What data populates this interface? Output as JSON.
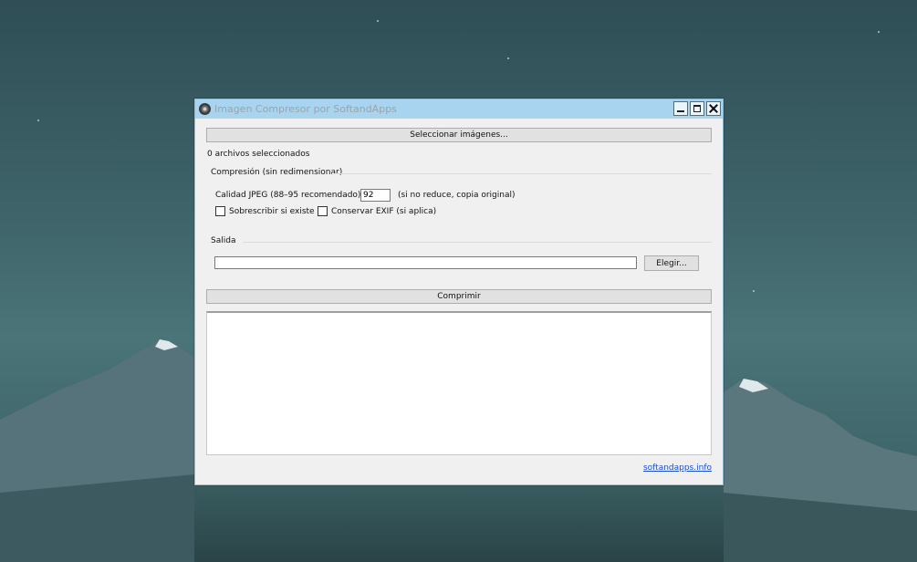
{
  "window": {
    "title": "Imagen Compresor por SoftandApps"
  },
  "actions": {
    "select_images_label": "Seleccionar imágenes...",
    "compress_label": "Comprimir",
    "choose_label": "Elegir..."
  },
  "status": {
    "selected_files": "0 archivos seleccionados"
  },
  "compression": {
    "group_label": "Compresión (sin redimensionar)",
    "quality_label": "Calidad JPEG (88–95 recomendado):",
    "quality_value": "92",
    "quality_hint": "(si no reduce, copia original)",
    "overwrite_label": "Sobrescribir si existe",
    "overwrite_checked": false,
    "exif_label": "Conservar EXIF (si aplica)",
    "exif_checked": false
  },
  "output": {
    "group_label": "Salida",
    "path_value": ""
  },
  "footer": {
    "link_text": "softandapps.info"
  },
  "colors": {
    "titlebar": "#a8d4ef",
    "window_bg": "#f0f0f0",
    "link": "#1a4fd1"
  }
}
